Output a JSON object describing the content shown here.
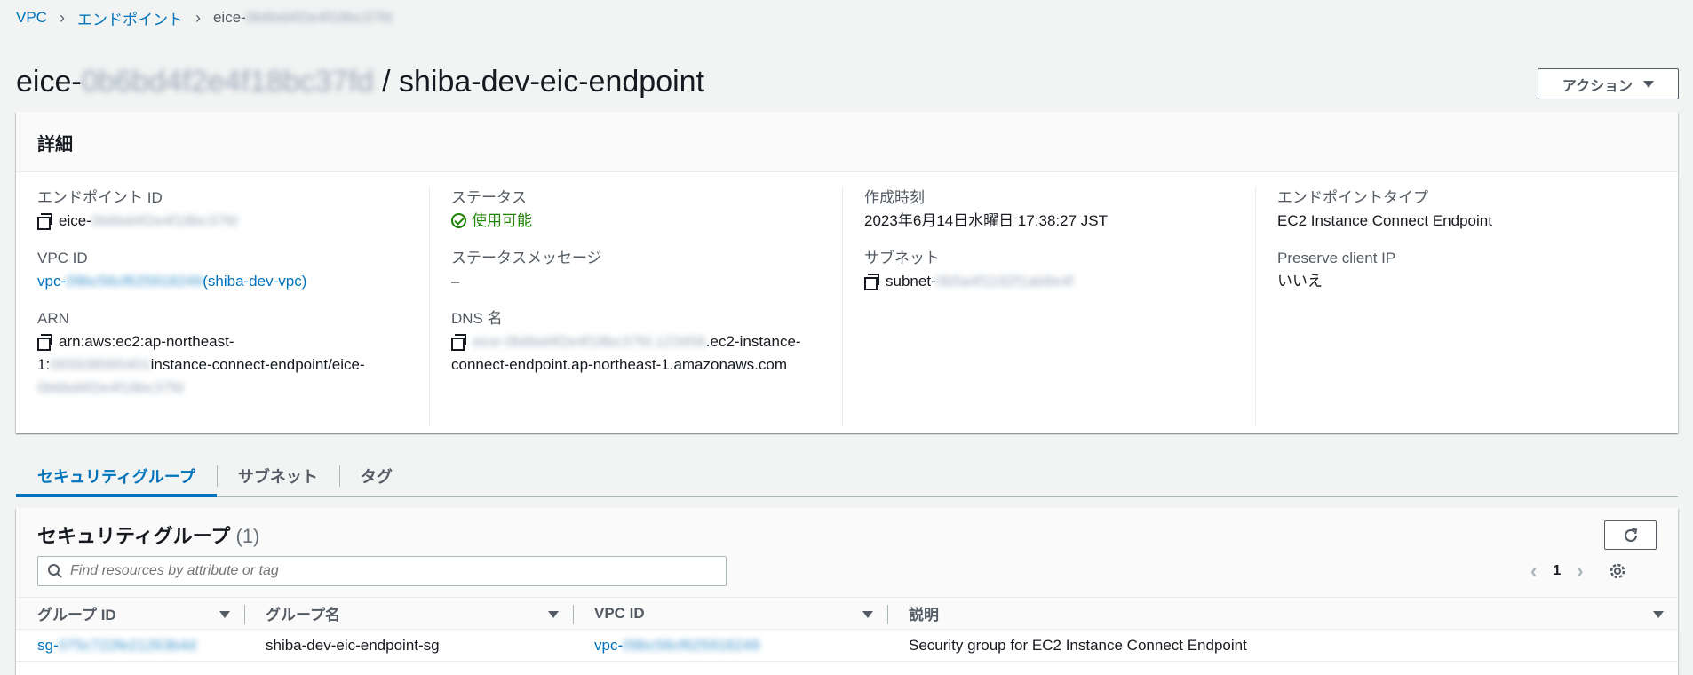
{
  "breadcrumb": {
    "items": [
      "VPC",
      "エンドポイント"
    ],
    "current_prefix": "eice-",
    "current_redacted": "0b6bd4f2e4f18bc37fd"
  },
  "title": {
    "prefix": "eice-",
    "redacted": "0b6bd4f2e4f18bc37fd",
    "suffix": " / shiba-dev-eic-endpoint"
  },
  "actions_label": "アクション",
  "details": {
    "heading": "詳細",
    "endpoint_id_label": "エンドポイント ID",
    "endpoint_id_prefix": "eice-",
    "endpoint_id_redacted": "0b6bd4f2e4f18bc37fd",
    "vpc_id_label": "VPC ID",
    "vpc_id_prefix": "vpc-",
    "vpc_id_redacted": "09bc56cf625918249",
    "vpc_id_name": "(shiba-dev-vpc)",
    "arn_label": "ARN",
    "arn_part1": "arn:aws:ec2:ap-northeast-",
    "arn_part2_prefix": "1:",
    "arn_part2_redacted": "065938565401",
    "arn_part2_suffix": "instance-connect-endpoint/eice-",
    "arn_part3_redacted": "0b6bd4f2e4f18bc37fd",
    "status_label": "ステータス",
    "status_value": "使用可能",
    "status_message_label": "ステータスメッセージ",
    "status_message_value": "–",
    "dns_label": "DNS 名",
    "dns_redacted": "eice-0b6bd4f2e4f18bc37fd.123456",
    "dns_suffix1": ".ec2-instance-",
    "dns_suffix2": "connect-endpoint.ap-northeast-1.amazonaws.com",
    "created_label": "作成時刻",
    "created_value": "2023年6月14日水曜日 17:38:27 JST",
    "subnet_label": "サブネット",
    "subnet_prefix": "subnet-",
    "subnet_redacted": "0b5a4f1192f1ab8e4f",
    "type_label": "エンドポイントタイプ",
    "type_value": "EC2 Instance Connect Endpoint",
    "preserve_label": "Preserve client IP",
    "preserve_value": "いいえ"
  },
  "tabs": [
    "セキュリティグループ",
    "サブネット",
    "タグ"
  ],
  "sg": {
    "title": "セキュリティグループ",
    "count": "(1)",
    "search_placeholder": "Find resources by attribute or tag",
    "page": "1",
    "columns": [
      "グループ ID",
      "グループ名",
      "VPC ID",
      "説明"
    ],
    "rows": [
      {
        "group_id_prefix": "sg-",
        "group_id_redacted": "075c722fe21263b4d",
        "group_name": "shiba-dev-eic-endpoint-sg",
        "vpc_id_prefix": "vpc-",
        "vpc_id_redacted": "09bc56cf625918249",
        "description": "Security group for EC2 Instance Connect Endpoint"
      }
    ]
  },
  "colors": {
    "link": "#0073bb",
    "success": "#1d8102",
    "text": "#16191f",
    "muted": "#545b64",
    "page_bg": "#f2f3f3"
  }
}
